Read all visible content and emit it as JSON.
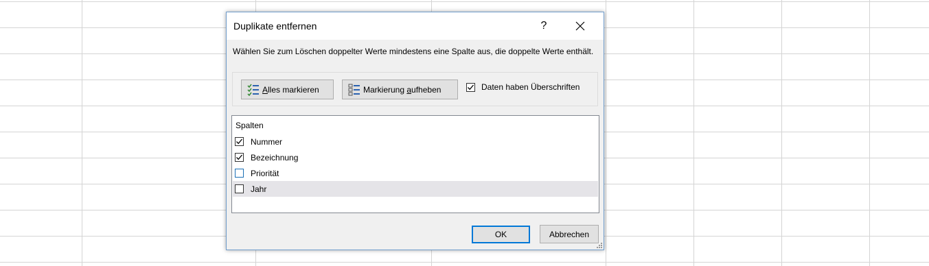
{
  "dialog": {
    "title": "Duplikate entfernen",
    "help_label": "?",
    "description": "Wählen Sie zum Löschen doppelter Werte mindestens eine Spalte aus, die doppelte Werte enthält.",
    "select_all_label_prefix": "",
    "select_all_label_accel": "A",
    "select_all_label_rest": "lles markieren",
    "unselect_label_prefix": "Markierung ",
    "unselect_label_accel": "a",
    "unselect_label_rest": "ufheben",
    "headers_checkbox": {
      "label": "Daten haben Überschriften",
      "checked": true
    },
    "columns_header": "Spalten",
    "columns": [
      {
        "label": "Nummer",
        "checked": true
      },
      {
        "label": "Bezeichnung",
        "checked": true
      },
      {
        "label": "Priorität",
        "checked": false
      },
      {
        "label": "Jahr",
        "checked": false
      }
    ],
    "ok_label": "OK",
    "cancel_label": "Abbrechen"
  },
  "colors": {
    "accent": "#0078d7",
    "dialog_border": "#6f9ccb",
    "selected_row": "#e5e4e8",
    "icon_green": "#3c8c3c",
    "icon_blue": "#2b62b0"
  },
  "icons": {
    "close": "close-icon",
    "select_all": "select-all-icon",
    "unselect_all": "unselect-all-icon"
  }
}
